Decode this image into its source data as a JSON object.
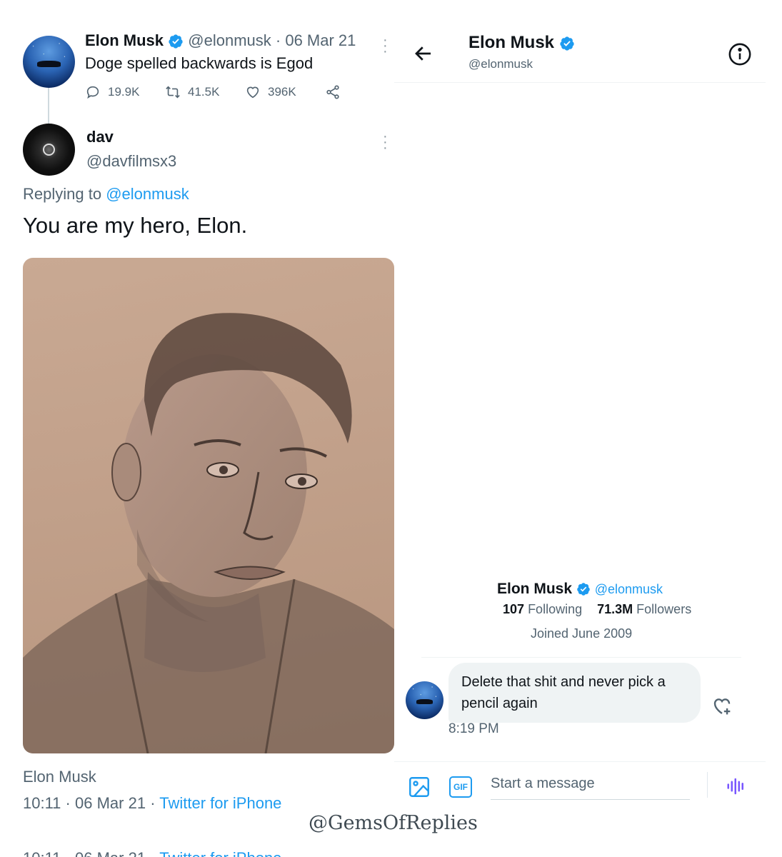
{
  "tweet": {
    "author_name": "Elon Musk",
    "author_handle": "@elonmusk",
    "meta_separator": "·",
    "date": "06 Mar 21",
    "text": "Doge spelled backwards is Egod",
    "replies": "19.9K",
    "retweets": "41.5K",
    "likes": "396K"
  },
  "reply": {
    "author_name": "dav",
    "author_handle": "@davfilmsx3",
    "replying_prefix": "Replying to",
    "replying_to": "@elonmusk",
    "text": "You are my hero, Elon.",
    "footer_author": "Elon Musk",
    "time": "10:11",
    "sep": "·",
    "date": "06 Mar 21",
    "source": "Twitter for iPhone"
  },
  "dm": {
    "header_name": "Elon Musk",
    "header_handle": "@elonmusk",
    "profile_name": "Elon Musk",
    "profile_handle": "@elonmusk",
    "following_count": "107",
    "following_label": "Following",
    "followers_count": "71.3M",
    "followers_label": "Followers",
    "joined": "Joined June 2009",
    "message": "Delete that shit and never pick a pencil again",
    "message_time": "8:19 PM",
    "composer_placeholder": "Start a message",
    "gif_label": "GIF"
  },
  "watermark": "@GemsOfReplies",
  "colors": {
    "accent": "#1d9bf0",
    "muted": "#536471",
    "bubble": "#eff3f4",
    "voice": "#7856ff"
  }
}
